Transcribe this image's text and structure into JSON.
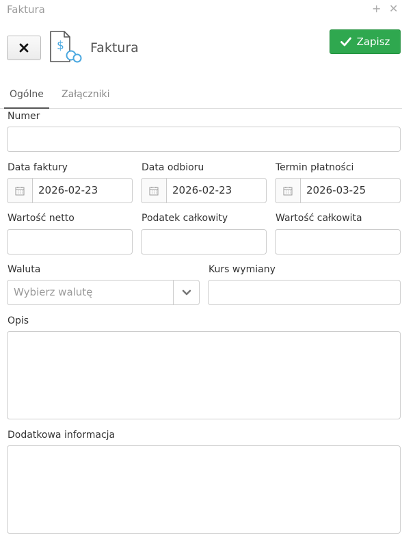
{
  "window": {
    "title": "Faktura"
  },
  "header": {
    "title": "Faktura",
    "save_label": "Zapisz"
  },
  "tabs": [
    {
      "label": "Ogólne"
    },
    {
      "label": "Załączniki"
    }
  ],
  "form": {
    "numer": {
      "label": "Numer",
      "value": ""
    },
    "data_faktury": {
      "label": "Data faktury",
      "value": "2026-02-23"
    },
    "data_odbioru": {
      "label": "Data odbioru",
      "value": "2026-02-23"
    },
    "termin_platnosci": {
      "label": "Termin płatności",
      "value": "2026-03-25"
    },
    "wartosc_netto": {
      "label": "Wartość netto",
      "value": ""
    },
    "podatek": {
      "label": "Podatek całkowity",
      "value": ""
    },
    "wartosc_calkowita": {
      "label": "Wartość całkowita",
      "value": ""
    },
    "waluta": {
      "label": "Waluta",
      "placeholder": "Wybierz walutę"
    },
    "kurs": {
      "label": "Kurs wymiany",
      "value": ""
    },
    "opis": {
      "label": "Opis",
      "value": ""
    },
    "dodatkowa": {
      "label": "Dodatkowa informacja",
      "value": ""
    }
  },
  "colors": {
    "save": "#2fa84f",
    "icon_blue": "#4aa8e0"
  }
}
